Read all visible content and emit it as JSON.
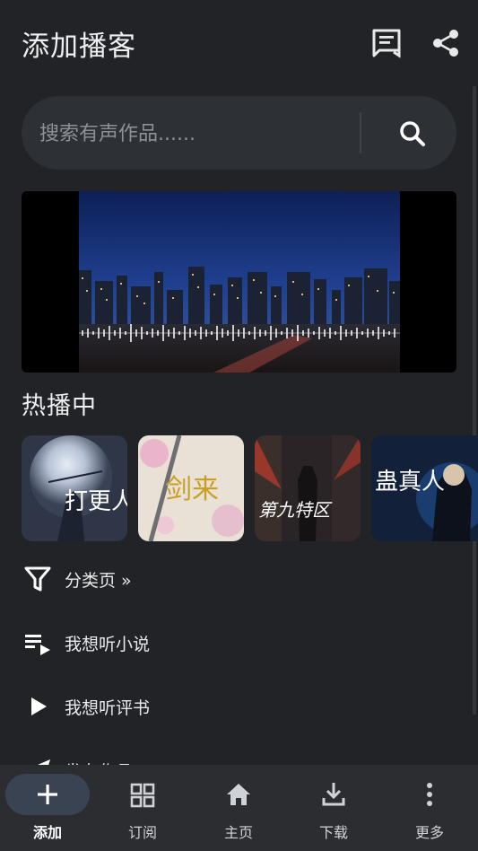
{
  "header": {
    "title": "添加播客",
    "icons": [
      "chat-list-icon",
      "share-icon"
    ]
  },
  "search": {
    "placeholder": "搜索有声作品......",
    "value": "",
    "icon": "search-icon"
  },
  "section": {
    "title": "热播中"
  },
  "covers": [
    {
      "name": "cover-1",
      "text": "打更人"
    },
    {
      "name": "cover-2",
      "text": "剑来"
    },
    {
      "name": "cover-3",
      "text": "第九特区"
    },
    {
      "name": "cover-4",
      "text": "蛊真人"
    }
  ],
  "menu": [
    {
      "label": "分类页 »",
      "icon": "filter-icon"
    },
    {
      "label": "我想听小说",
      "icon": "playlist-icon"
    },
    {
      "label": "我想听评书",
      "icon": "play-icon"
    },
    {
      "label": "发布作品",
      "icon": "send-icon"
    }
  ],
  "bottom_nav": [
    {
      "label": "添加",
      "icon": "plus-icon",
      "active": true
    },
    {
      "label": "订阅",
      "icon": "grid-icon",
      "active": false
    },
    {
      "label": "主页",
      "icon": "home-icon",
      "active": false
    },
    {
      "label": "下载",
      "icon": "download-icon",
      "active": false
    },
    {
      "label": "更多",
      "icon": "more-vertical-icon",
      "active": false
    }
  ],
  "colors": {
    "background": "#212326",
    "surface": "#2d3034",
    "nav_background": "#2b2d31",
    "active_pill": "#3a4352"
  }
}
